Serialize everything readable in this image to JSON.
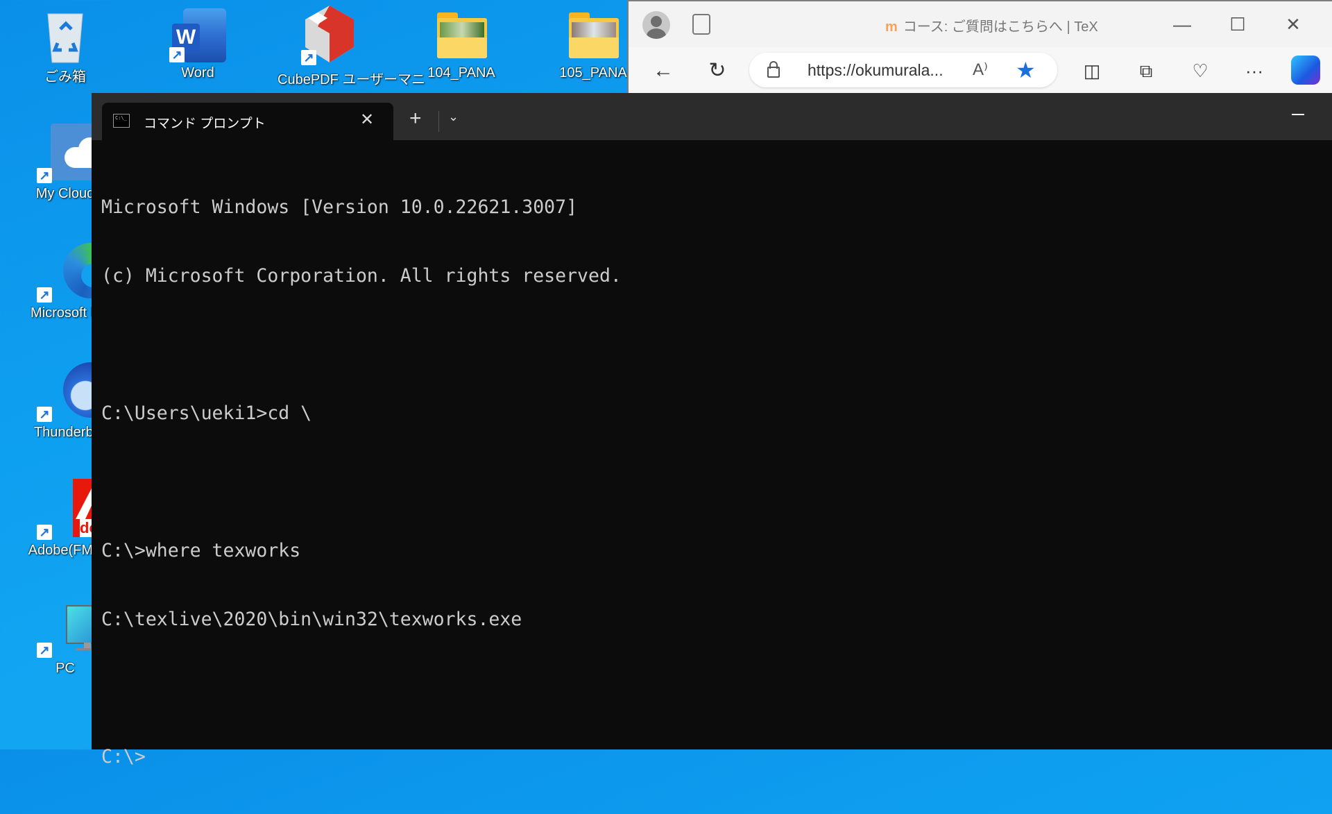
{
  "desktop": {
    "icons": [
      {
        "label": "ごみ箱",
        "icon": "recycle-bin-icon"
      },
      {
        "label": "Word",
        "icon": "word-icon"
      },
      {
        "label": "CubePDF ユーザーマニ",
        "icon": "cubepdf-icon"
      },
      {
        "label": "104_PANA",
        "icon": "folder-icon"
      },
      {
        "label": "105_PANA",
        "icon": "folder-icon"
      },
      {
        "label": "My Cloud",
        "icon": "cloud-icon"
      },
      {
        "label": "Microsoft E",
        "icon": "edge-icon"
      },
      {
        "label": "Thunderbi",
        "icon": "thunderbird-icon"
      },
      {
        "label": "Adobe(FMV",
        "icon": "adobe-icon"
      },
      {
        "label": "PC",
        "icon": "pc-icon"
      }
    ]
  },
  "browser": {
    "tab_title": "コース: ご質問はこちらへ | TeX",
    "favicon_text": "m",
    "url": "https://okumurala...",
    "read_aloud_glyph": "A⁾",
    "buttons": {
      "minimize": "—",
      "maximize": "☐",
      "close": "✕",
      "back": "←",
      "refresh": "↻",
      "split": "◫",
      "collections": "⧉",
      "health": "♡",
      "more": "···"
    }
  },
  "terminal": {
    "tab_title": "コマンド プロンプト",
    "tab_close": "✕",
    "new_tab": "+",
    "dropdown": "⌄",
    "lines": [
      "Microsoft Windows [Version 10.0.22621.3007]",
      "(c) Microsoft Corporation. All rights reserved.",
      "",
      "C:\\Users\\ueki1>cd \\",
      "",
      "C:\\>where texworks",
      "C:\\texlive\\2020\\bin\\win32\\texworks.exe",
      "",
      "C:\\>"
    ]
  }
}
